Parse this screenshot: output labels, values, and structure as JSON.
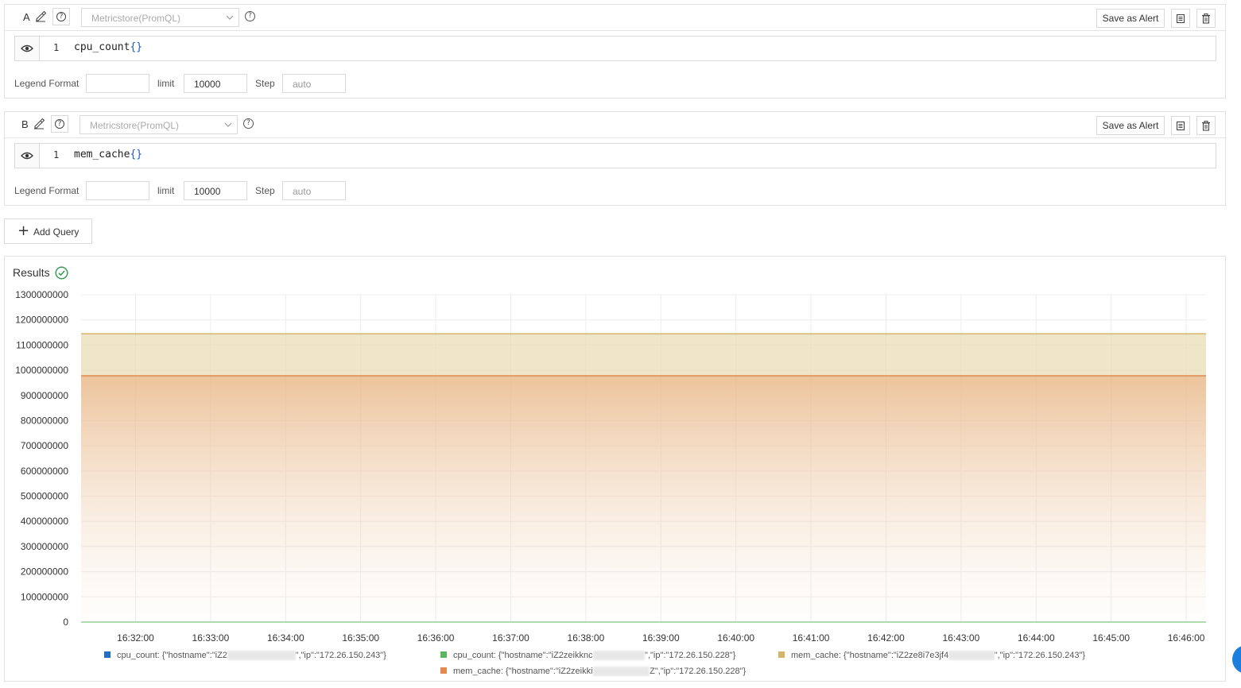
{
  "queries": [
    {
      "letter": "A",
      "datasource": "Metricstore(PromQL)",
      "save_alert_label": "Save as Alert",
      "line_number": "1",
      "code_metric": "cpu_count",
      "code_braces": "{}",
      "legend_format_label": "Legend Format",
      "legend_format_value": "",
      "limit_label": "limit",
      "limit_value": "10000",
      "step_label": "Step",
      "step_placeholder": "auto"
    },
    {
      "letter": "B",
      "datasource": "Metricstore(PromQL)",
      "save_alert_label": "Save as Alert",
      "line_number": "1",
      "code_metric": "mem_cache",
      "code_braces": "{}",
      "legend_format_label": "Legend Format",
      "legend_format_value": "",
      "limit_label": "limit",
      "limit_value": "10000",
      "step_label": "Step",
      "step_placeholder": "auto"
    }
  ],
  "add_query_label": "Add Query",
  "results": {
    "title": "Results",
    "status": "success"
  },
  "legend": [
    {
      "color": "#1f6fc9",
      "prefix": "cpu_count: {\"hostname\":\"iZ2",
      "masked": "ze1xq8b9s1onl3z",
      "suffix": "\",\"ip\":\"172.26.150.243\"}"
    },
    {
      "color": "#5cb85c",
      "prefix": "cpu_count: {\"hostname\":\"iZ2zeikknc",
      "masked": "3ek0xqd8bva",
      "suffix": "\",\"ip\":\"172.26.150.228\"}"
    },
    {
      "color": "#d6b46b",
      "prefix": "mem_cache: {\"hostname\":\"iZ2ze8i7e3jf4",
      "masked": "ab1cd2ef3g",
      "suffix": "\",\"ip\":\"172.26.150.243\"}"
    },
    {
      "color": "#e08a4f",
      "prefix": "mem_cache: {\"hostname\":\"iZ2zeikki",
      "masked": "n3ek0xqd8bva",
      "suffix": "Z\",\"ip\":\"172.26.150.228\"}"
    }
  ],
  "chart_data": {
    "type": "area",
    "x": [
      "16:32:00",
      "16:33:00",
      "16:34:00",
      "16:35:00",
      "16:36:00",
      "16:37:00",
      "16:38:00",
      "16:39:00",
      "16:40:00",
      "16:41:00",
      "16:42:00",
      "16:43:00",
      "16:44:00",
      "16:45:00",
      "16:46:00"
    ],
    "ylim": [
      0,
      1300000000
    ],
    "yticks": [
      "1300000000",
      "1200000000",
      "1100000000",
      "1000000000",
      "900000000",
      "800000000",
      "700000000",
      "600000000",
      "500000000",
      "400000000",
      "300000000",
      "200000000",
      "100000000",
      "0"
    ],
    "series": [
      {
        "name": "cpu_count: {\"hostname\":\"iZ2…\",\"ip\":\"172.26.150.243\"}",
        "value": 4,
        "color": "#1f6fc9"
      },
      {
        "name": "cpu_count: {\"hostname\":\"iZ2zeikknc…\",\"ip\":\"172.26.150.228\"}",
        "value": 4,
        "color": "#5cb85c"
      },
      {
        "name": "mem_cache: {\"hostname\":\"iZ2ze8i7e3jf4…\",\"ip\":\"172.26.150.243\"}",
        "value": 1145000000,
        "color": "#d6b46b"
      },
      {
        "name": "mem_cache: {\"hostname\":\"iZ2zeikki…\",\"ip\":\"172.26.150.228\"}",
        "value": 978000000,
        "color": "#e08a4f"
      }
    ],
    "grid": true,
    "legend_position": "bottom"
  }
}
